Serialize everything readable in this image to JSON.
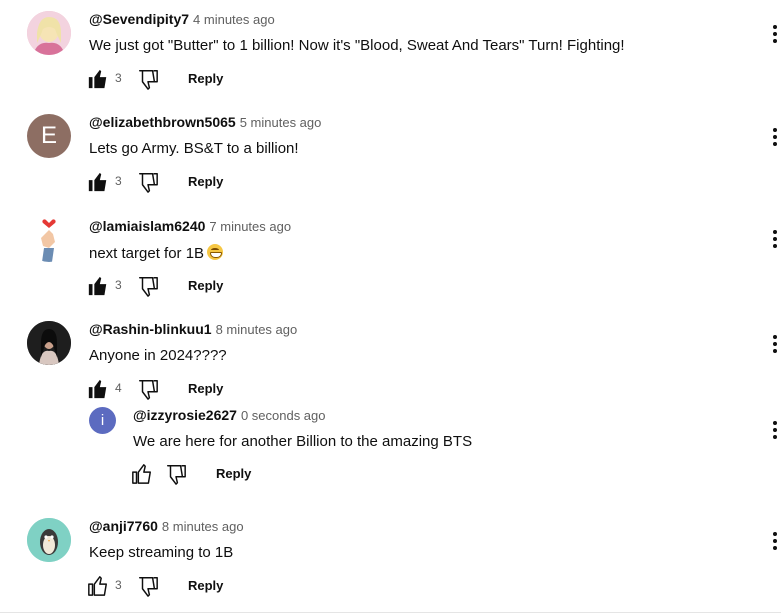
{
  "comments": [
    {
      "author": "@Sevendipity7",
      "time": "4 minutes ago",
      "text": "We just got \"Butter\" to 1 billion! Now it's \"Blood, Sweat And Tears\" Turn! Fighting!",
      "likes": "3",
      "reply": "Reply",
      "liked": true,
      "avatar_color": "#e9b3c6"
    },
    {
      "author": "@elizabethbrown5065",
      "time": "5 minutes ago",
      "text": "Lets go Army. BS&T to a billion!",
      "likes": "3",
      "reply": "Reply",
      "liked": true,
      "avatar_letter": "E",
      "avatar_color": "#8d6e63"
    },
    {
      "author": "@lamiaislam6240",
      "time": "7 minutes ago",
      "text": "next target for 1B",
      "emoji": "grinning-face-emoji",
      "likes": "3",
      "reply": "Reply",
      "liked": true,
      "avatar_color": "#ffffff"
    },
    {
      "author": "@Rashin-blinkuu1",
      "time": "8 minutes ago",
      "text": "Anyone in 2024????",
      "likes": "4",
      "reply": "Reply",
      "liked": true,
      "avatar_color": "#2b2b2b"
    },
    {
      "author": "@izzyrosie2627",
      "time": "0 seconds ago",
      "text": "We are here for another Billion to the amazing BTS",
      "likes": "",
      "reply": "Reply",
      "liked": false,
      "avatar_letter": "i",
      "avatar_color": "#5c6bc0"
    },
    {
      "author": "@anji7760",
      "time": "8 minutes ago",
      "text": "Keep streaming to 1B",
      "likes": "3",
      "reply": "Reply",
      "liked": false,
      "avatar_color": "#7fd1c4"
    }
  ]
}
